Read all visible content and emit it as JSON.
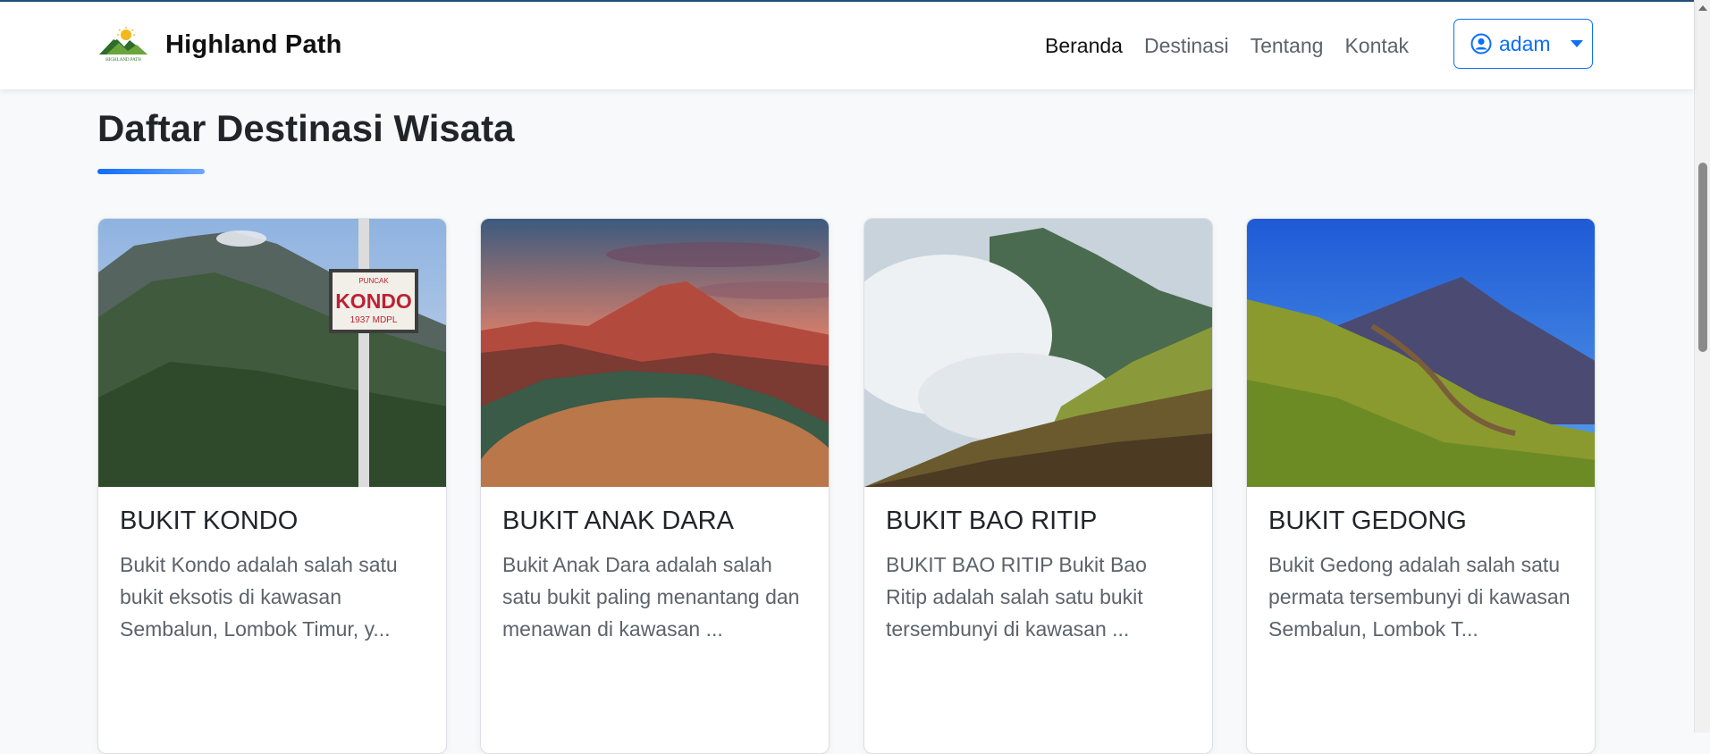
{
  "brand": {
    "name": "Highland Path",
    "logo_icon": "mountain-logo-icon",
    "logo_text": "HIGHLAND PATH"
  },
  "nav": {
    "items": [
      {
        "label": "Beranda",
        "active": true
      },
      {
        "label": "Destinasi",
        "active": false
      },
      {
        "label": "Tentang",
        "active": false
      },
      {
        "label": "Kontak",
        "active": false
      }
    ]
  },
  "user": {
    "name": "adam",
    "icon": "user-circle-icon"
  },
  "page": {
    "heading": "Daftar Destinasi Wisata"
  },
  "cards": [
    {
      "title": "BUKIT KONDO",
      "text": "Bukit Kondo adalah salah satu bukit eksotis di kawasan Sembalun, Lombok Timur, y...",
      "image_sign": {
        "top": "PUNCAK",
        "main": "KONDO",
        "sub": "1937 MDPL"
      }
    },
    {
      "title": "BUKIT ANAK DARA",
      "text": "Bukit Anak Dara adalah salah satu bukit paling menantang dan menawan di kawasan ..."
    },
    {
      "title": "BUKIT BAO RITIP",
      "text": "BUKIT BAO RITIP Bukit Bao Ritip adalah salah satu bukit tersembunyi di kawasan ..."
    },
    {
      "title": "BUKIT GEDONG",
      "text": "Bukit Gedong adalah salah satu permata tersembunyi di kawasan Sembalun, Lombok T..."
    }
  ],
  "colors": {
    "accent": "#0d6efd",
    "nav_border": "#1f4e79"
  }
}
